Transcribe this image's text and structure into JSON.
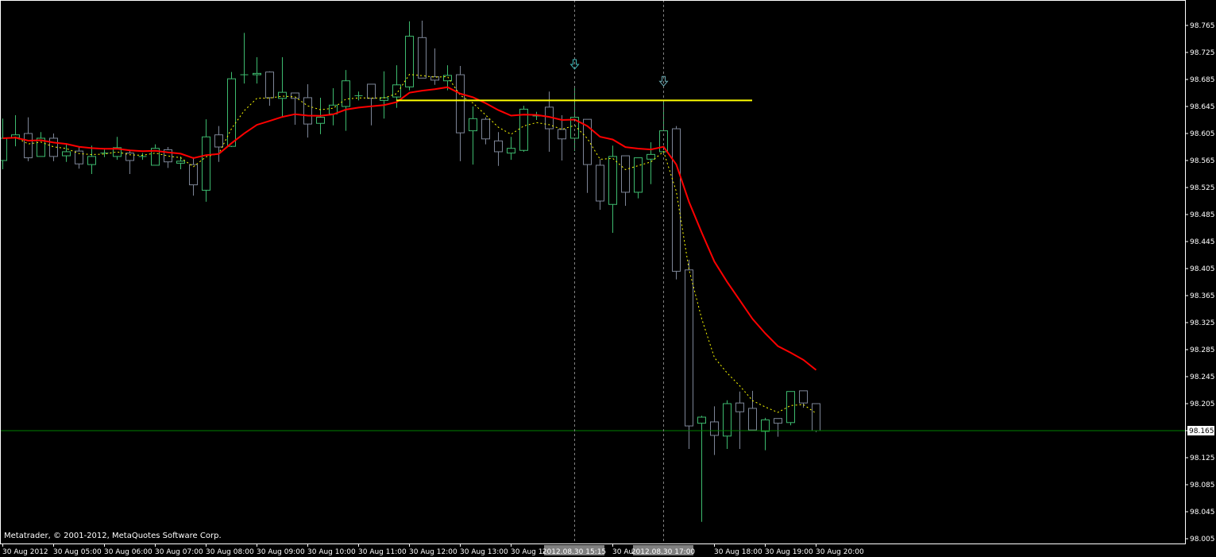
{
  "chart_data": {
    "type": "candlestick",
    "symbol_timeframe": "M15",
    "copyright": "Metatrader, © 2001-2012, MetaQuotes Software Corp.",
    "ylim": [
      98.005,
      98.765
    ],
    "y_ticks": [
      "98.765",
      "98.725",
      "98.685",
      "98.645",
      "98.605",
      "98.565",
      "98.525",
      "98.485",
      "98.445",
      "98.405",
      "98.365",
      "98.325",
      "98.285",
      "98.245",
      "98.205",
      "98.165",
      "98.125",
      "98.085",
      "98.045",
      "98.005"
    ],
    "current_price": "98.165",
    "x_labels": [
      {
        "bar": 0,
        "text": "30 Aug 2012"
      },
      {
        "bar": 4,
        "text": "30 Aug 05:00"
      },
      {
        "bar": 8,
        "text": "30 Aug 06:00"
      },
      {
        "bar": 12,
        "text": "30 Aug 07:00"
      },
      {
        "bar": 16,
        "text": "30 Aug 08:00"
      },
      {
        "bar": 20,
        "text": "30 Aug 09:00"
      },
      {
        "bar": 24,
        "text": "30 Aug 10:00"
      },
      {
        "bar": 28,
        "text": "30 Aug 11:00"
      },
      {
        "bar": 32,
        "text": "30 Aug 12:00"
      },
      {
        "bar": 36,
        "text": "30 Aug 13:00"
      },
      {
        "bar": 40,
        "text": "30 Aug 14:00"
      },
      {
        "bar": 48,
        "text": "30 Aug 16:00"
      },
      {
        "bar": 56,
        "text": "30 Aug 18:00"
      },
      {
        "bar": 60,
        "text": "30 Aug 19:00"
      },
      {
        "bar": 64,
        "text": "30 Aug 20:00"
      }
    ],
    "vertical_markers": [
      {
        "bar": 45,
        "label": "2012.08.30 15:15"
      },
      {
        "bar": 52,
        "label": "2012.08.30 17:00"
      }
    ],
    "arrows": [
      {
        "bar": 45,
        "price": 98.705,
        "direction": "down",
        "color": "#3fb5b5"
      },
      {
        "bar": 52,
        "price": 98.68,
        "direction": "down",
        "color": "#6aa8b0"
      }
    ],
    "horizontal_line": {
      "price": 98.654,
      "from_bar": 31,
      "to_bar": 59,
      "color": "#ffff00"
    },
    "indicators": [
      {
        "type": "EMA",
        "period": 5,
        "color": "#ffff00",
        "style": "dotted"
      },
      {
        "type": "EMA",
        "period": 13,
        "color": "#ff0000",
        "style": "solid"
      }
    ],
    "colors": {
      "bull": "#3dba6e",
      "bear": "#7d8597",
      "background": "#000000",
      "axis": "#ffffff",
      "bid_line": "#008000"
    },
    "ohlc": [
      [
        98.565,
        98.627,
        98.552,
        98.598
      ],
      [
        98.599,
        98.632,
        98.586,
        98.603
      ],
      [
        98.605,
        98.629,
        98.564,
        98.569
      ],
      [
        98.571,
        98.607,
        98.571,
        98.598
      ],
      [
        98.598,
        98.605,
        98.564,
        98.571
      ],
      [
        98.572,
        98.589,
        98.563,
        98.578
      ],
      [
        98.579,
        98.586,
        98.553,
        98.56
      ],
      [
        98.559,
        98.587,
        98.545,
        98.571
      ],
      [
        98.576,
        98.581,
        98.57,
        98.576
      ],
      [
        98.571,
        98.6,
        98.566,
        98.584
      ],
      [
        98.576,
        98.581,
        98.545,
        98.565
      ],
      [
        98.571,
        98.576,
        98.566,
        98.571
      ],
      [
        98.558,
        98.589,
        98.558,
        98.583
      ],
      [
        98.581,
        98.585,
        98.554,
        98.563
      ],
      [
        98.561,
        98.571,
        98.552,
        98.564
      ],
      [
        98.559,
        98.57,
        98.513,
        98.529
      ],
      [
        98.521,
        98.626,
        98.504,
        98.6
      ],
      [
        98.603,
        98.616,
        98.563,
        98.585
      ],
      [
        98.586,
        98.696,
        98.585,
        98.686
      ],
      [
        98.692,
        98.754,
        98.679,
        98.692
      ],
      [
        98.692,
        98.718,
        98.679,
        98.694
      ],
      [
        98.696,
        98.697,
        98.646,
        98.658
      ],
      [
        98.657,
        98.718,
        98.63,
        98.666
      ],
      [
        98.665,
        98.665,
        98.618,
        98.657
      ],
      [
        98.658,
        98.678,
        98.599,
        98.619
      ],
      [
        98.62,
        98.658,
        98.604,
        98.629
      ],
      [
        98.634,
        98.672,
        98.617,
        98.647
      ],
      [
        98.645,
        98.699,
        98.609,
        98.683
      ],
      [
        98.661,
        98.667,
        98.654,
        98.661
      ],
      [
        98.678,
        98.678,
        98.617,
        98.657
      ],
      [
        98.654,
        98.697,
        98.627,
        98.658
      ],
      [
        98.659,
        98.706,
        98.643,
        98.677
      ],
      [
        98.674,
        98.771,
        98.669,
        98.749
      ],
      [
        98.747,
        98.772,
        98.687,
        98.687
      ],
      [
        98.689,
        98.731,
        98.677,
        98.684
      ],
      [
        98.683,
        98.706,
        98.669,
        98.691
      ],
      [
        98.692,
        98.705,
        98.564,
        98.606
      ],
      [
        98.609,
        98.645,
        98.559,
        98.627
      ],
      [
        98.626,
        98.629,
        98.589,
        98.597
      ],
      [
        98.594,
        98.607,
        98.557,
        98.578
      ],
      [
        98.576,
        98.6,
        98.566,
        98.583
      ],
      [
        98.58,
        98.646,
        98.578,
        98.641
      ],
      [
        98.631,
        98.637,
        98.625,
        98.631
      ],
      [
        98.644,
        98.667,
        98.578,
        98.612
      ],
      [
        98.611,
        98.632,
        98.565,
        98.597
      ],
      [
        98.598,
        98.672,
        98.579,
        98.629
      ],
      [
        98.626,
        98.626,
        98.517,
        98.559
      ],
      [
        98.558,
        98.567,
        98.492,
        98.505
      ],
      [
        98.5,
        98.587,
        98.458,
        98.571
      ],
      [
        98.572,
        98.572,
        98.498,
        98.518
      ],
      [
        98.518,
        98.569,
        98.509,
        98.569
      ],
      [
        98.567,
        98.592,
        98.53,
        98.574
      ],
      [
        98.578,
        98.651,
        98.578,
        98.609
      ],
      [
        98.612,
        98.616,
        98.389,
        98.401
      ],
      [
        98.403,
        98.418,
        98.138,
        98.172
      ],
      [
        98.176,
        98.187,
        98.03,
        98.185
      ],
      [
        98.178,
        98.201,
        98.129,
        98.158
      ],
      [
        98.157,
        98.21,
        98.138,
        98.205
      ],
      [
        98.206,
        98.223,
        98.138,
        98.193
      ],
      [
        98.198,
        98.224,
        98.166,
        98.166
      ],
      [
        98.164,
        98.184,
        98.136,
        98.181
      ],
      [
        98.183,
        98.183,
        98.156,
        98.176
      ],
      [
        98.177,
        98.223,
        98.173,
        98.223
      ],
      [
        98.224,
        98.224,
        98.199,
        98.206
      ],
      [
        98.205,
        98.205,
        98.163,
        98.165
      ]
    ]
  }
}
